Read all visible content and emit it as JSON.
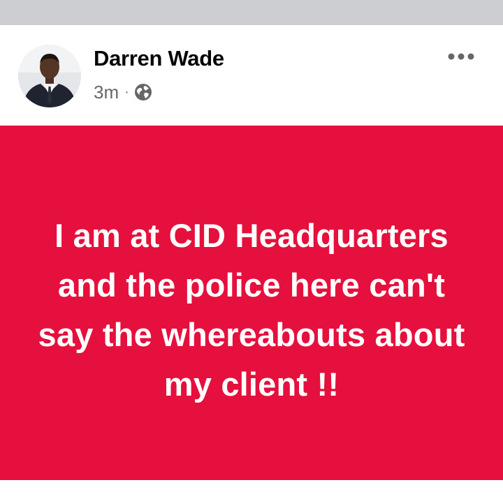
{
  "post": {
    "author": "Darren Wade",
    "timestamp": "3m",
    "separator": "·",
    "privacy_icon": "globe-icon",
    "more_icon": "more-horizontal-icon",
    "body_text": "I am at CID Headquarters and the police here can't say the whereabouts about my client !!"
  },
  "colors": {
    "post_background": "#e5103d",
    "post_text": "#ffffff",
    "divider": "#ccced2",
    "meta_text": "#65676b"
  }
}
